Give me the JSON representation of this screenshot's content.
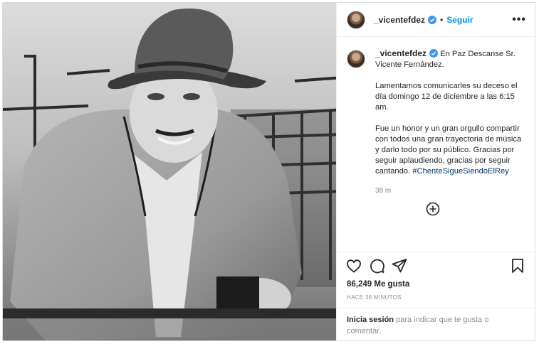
{
  "post": {
    "header": {
      "username": "_vicentefdez",
      "separator": "•",
      "follow_label": "Seguir",
      "more_label": "•••"
    },
    "caption": {
      "username": "_vicentefdez",
      "lead": "En Paz Descanse Sr. Vicente Fernández.",
      "paragraph2": "Lamentamos comunicarles su deceso el día domingo 12 de diciembre a las 6:15 am.",
      "paragraph3": "Fue un honor y un gran orgullo compartir con todos una gran trayectoria de música y darlo todo por su público. Gracias por seguir aplaudiendo, gracias por seguir cantando.",
      "hashtag": "#ChenteSigueSiendoElRey",
      "time": "38 m"
    },
    "likes": "86,249 Me gusta",
    "ago": "HACE 38 MINUTOS",
    "login": {
      "link": "Inicia sesión",
      "text": " para indicar que te gusta o comentar."
    }
  },
  "colors": {
    "accent": "#0095f6",
    "verified": "#3897f0",
    "hashtag": "#00376b",
    "muted": "#8e8e8e",
    "border": "#dbdbdb"
  },
  "icons": [
    "verified-badge-icon",
    "more-options-icon",
    "load-more-icon",
    "heart-icon",
    "comment-icon",
    "share-icon",
    "bookmark-icon"
  ]
}
